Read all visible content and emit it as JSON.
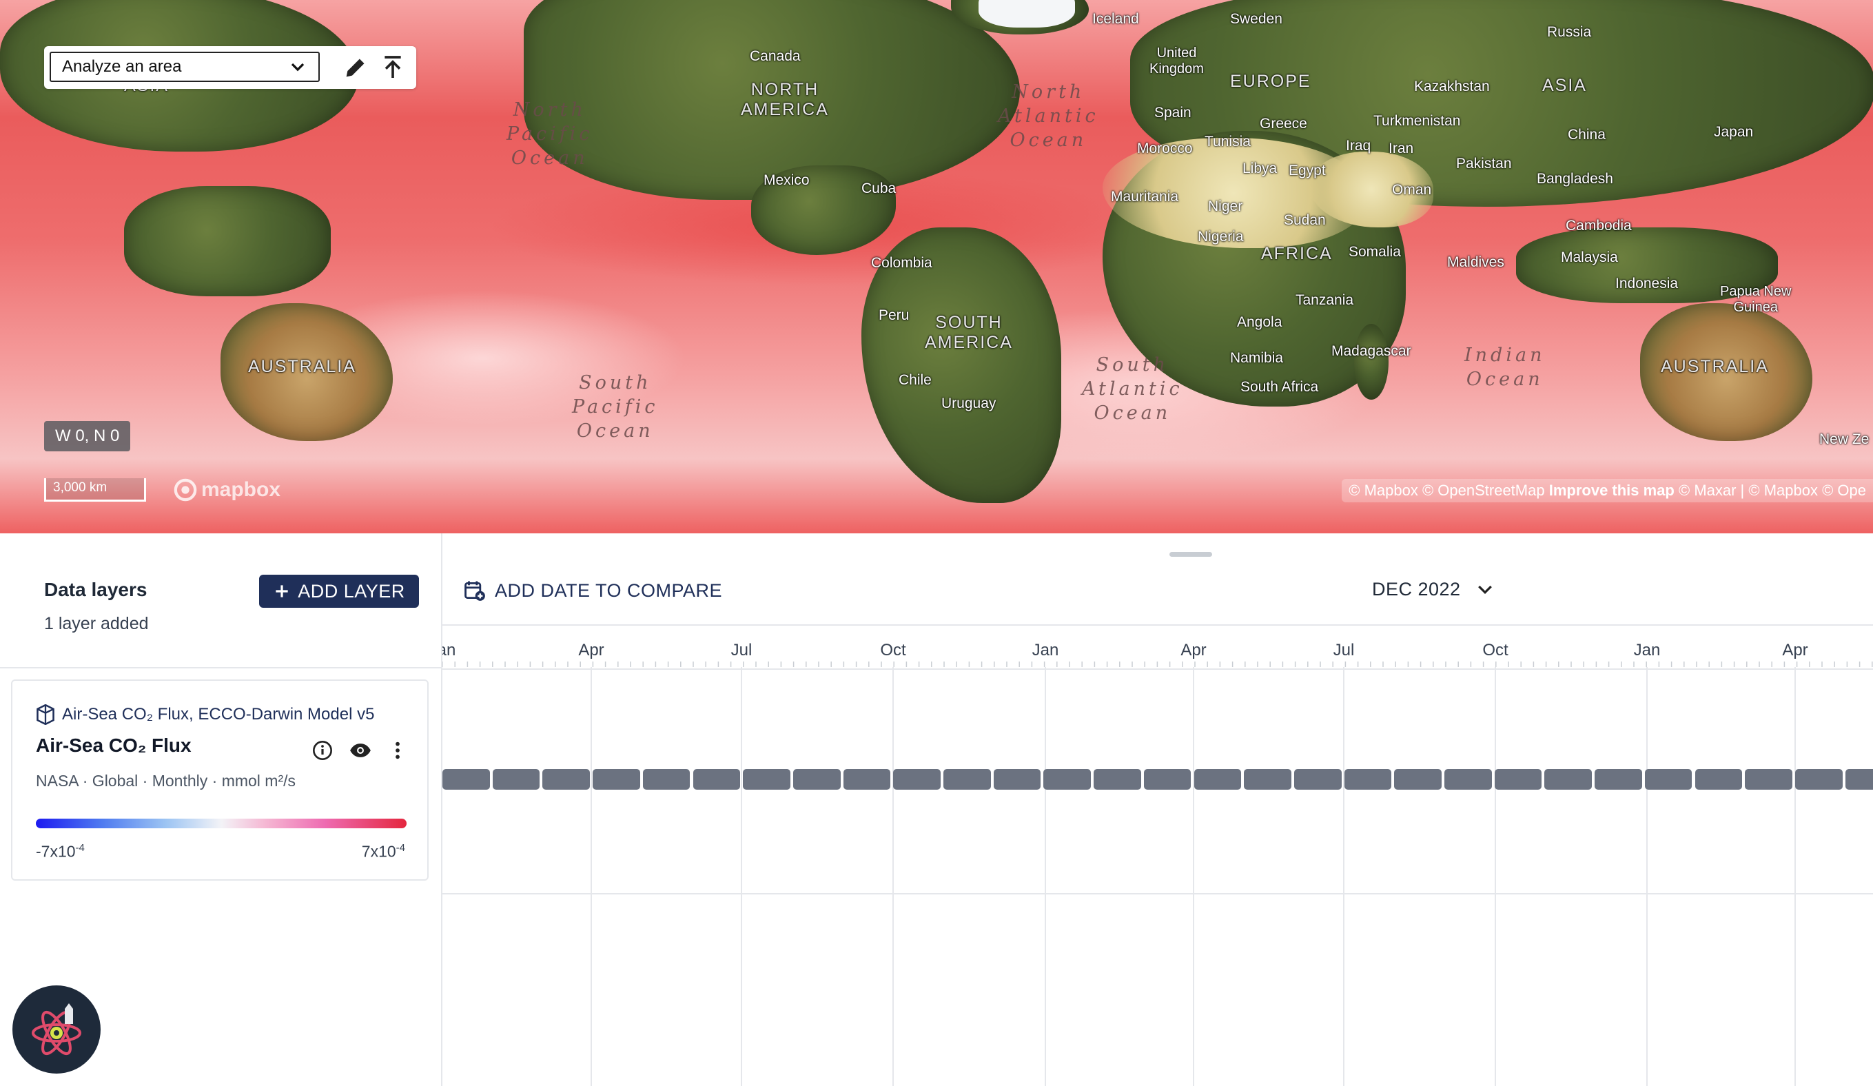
{
  "map": {
    "analyze": {
      "selected": "Analyze an area"
    },
    "coords": "W 0, N 0",
    "scale": "3,000 km",
    "logo": "mapbox",
    "attribution": {
      "a": "© Mapbox © OpenStreetMap",
      "improve": "Improve this map",
      "b": "© Maxar | © Mapbox © Ope"
    },
    "labels": {
      "iceland": "Iceland",
      "sweden": "Sweden",
      "russia": "Russia",
      "canada": "Canada",
      "uk": "United\nKingdom",
      "europe": "EUROPE",
      "kazakhstan": "Kazakhstan",
      "asia": "ASIA",
      "north_america": "NORTH\nAMERICA",
      "spain": "Spain",
      "greece": "Greece",
      "turkmenistan": "Turkmenistan",
      "morocco": "Morocco",
      "tunisia": "Tunisia",
      "iraq": "Iraq",
      "iran": "Iran",
      "china": "China",
      "japan": "Japan",
      "libya": "Libya",
      "egypt": "Egypt",
      "pakistan": "Pakistan",
      "mexico": "Mexico",
      "cuba": "Cuba",
      "bangladesh": "Bangladesh",
      "oman": "Oman",
      "mauritania": "Mauritania",
      "niger": "Niger",
      "sudan": "Sudan",
      "cambodia": "Cambodia",
      "nigeria": "Nigeria",
      "africa": "AFRICA",
      "somalia": "Somalia",
      "maldives": "Maldives",
      "malaysia": "Malaysia",
      "colombia": "Colombia",
      "indonesia": "Indonesia",
      "papua": "Papua New\nGuinea",
      "tanzania": "Tanzania",
      "peru": "Peru",
      "south_america": "SOUTH\nAMERICA",
      "angola": "Angola",
      "australia_left": "AUSTRALIA",
      "australia_right": "AUSTRALIA",
      "namibia": "Namibia",
      "madagascar": "Madagascar",
      "chile": "Chile",
      "south_africa": "South Africa",
      "uruguay": "Uruguay",
      "new_zealand": "New Ze",
      "asia_left": "ASIA"
    },
    "oceans": {
      "north_pacific": "North\nPacific\nOcean",
      "north_atlantic": "North\nAtlantic\nOcean",
      "south_pacific": "South\nPacific\nOcean",
      "south_atlantic": "South\nAtlantic\nOcean",
      "indian": "Indian\nOcean"
    }
  },
  "layers_panel": {
    "title": "Data layers",
    "count": "1 layer added",
    "add_button": "ADD LAYER"
  },
  "layer": {
    "dataset": "Air-Sea CO₂ Flux, ECCO-Darwin Model v5",
    "name": "Air-Sea CO₂ Flux",
    "meta": "NASA · Global · Monthly · mmol m²/s",
    "legend_min_base": "-7x10",
    "legend_min_exp": "-4",
    "legend_max_base": "7x10",
    "legend_max_exp": "-4",
    "colormap": [
      "#1d1bf0",
      "#9cc4f3",
      "#f3f3f7",
      "#ee6bb1",
      "#e4263e"
    ]
  },
  "timeline": {
    "compare_button": "ADD DATE TO COMPARE",
    "selected_date": "DEC 2022",
    "ticks": [
      "Jan",
      "Apr",
      "Jul",
      "Oct",
      "Jan",
      "Apr",
      "Jul",
      "Oct",
      "Jan",
      "Apr"
    ],
    "first_tick_visible": "an"
  }
}
